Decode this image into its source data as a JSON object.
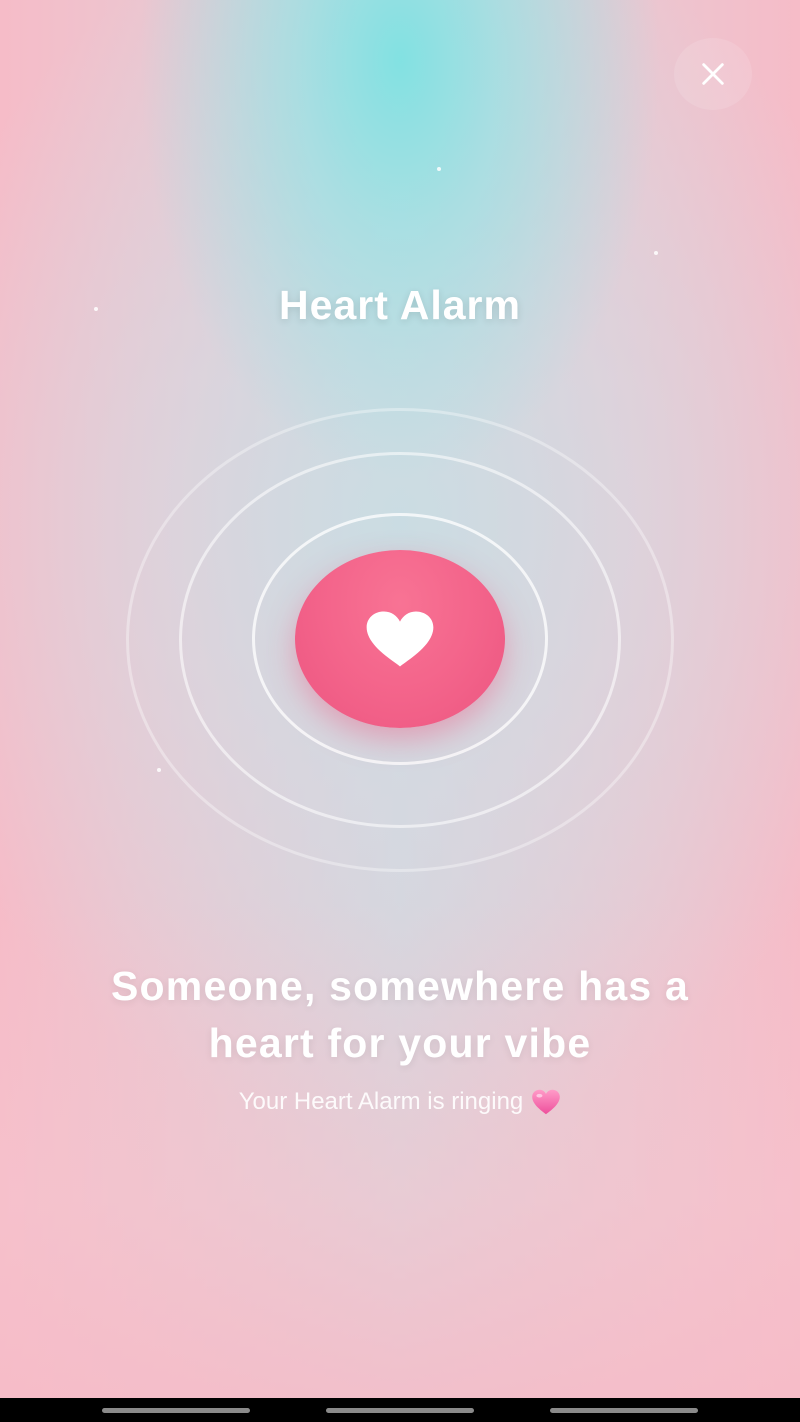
{
  "app": {
    "title": "Heart Alarm"
  },
  "header": {
    "close_icon": "close-icon"
  },
  "main": {
    "heart_icon": "heart-icon",
    "headline_line1": "Someone, somewhere has a",
    "headline_line2": "heart for your vibe",
    "subtext": "Your Heart Alarm is ringing",
    "subtext_icon": "pink-heart-emoji"
  },
  "colors": {
    "accent": "#f3638a",
    "background_teal": "#86e3e3",
    "background_pink": "#f6bcc8",
    "text": "#ffffff"
  }
}
